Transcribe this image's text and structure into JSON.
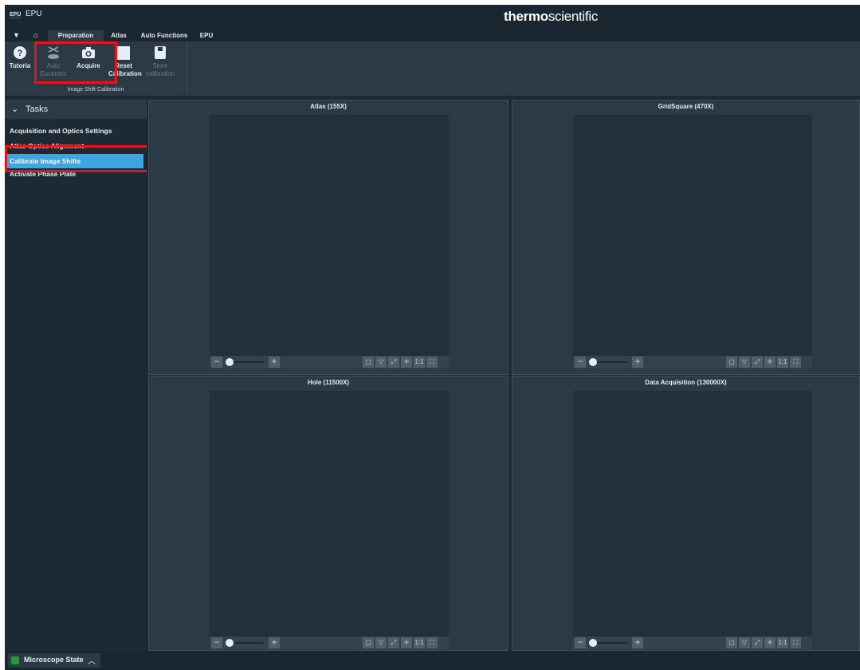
{
  "app": {
    "badge": "EPU",
    "title": "EPU",
    "brand_bold": "thermo",
    "brand_light": "scientific"
  },
  "tabs": [
    {
      "label": "Preparation"
    },
    {
      "label": "Atlas"
    },
    {
      "label": "Auto Functions"
    },
    {
      "label": "EPU"
    }
  ],
  "ribbon": {
    "tutorial": "Tutoria",
    "auto_eucentric_1": "Auto",
    "auto_eucentric_2": "Eucentric",
    "acquire": "Acquire",
    "reset_1": "Reset",
    "reset_2": "Calibration",
    "store_1": "Store",
    "store_2": "calibration",
    "group_label": "Image Shift Calibration"
  },
  "sidebar": {
    "header": "Tasks",
    "items": [
      {
        "label": "Acquisition and Optics Settings"
      },
      {
        "label": "Atlas Optics Alignment"
      },
      {
        "label": "Calibrate Image Shifts"
      },
      {
        "label": "Activate Phase Plate"
      }
    ]
  },
  "panels": [
    {
      "title": "Atlas (155X)"
    },
    {
      "title": "GridSquare (470X)"
    },
    {
      "title": "Hole (11500X)"
    },
    {
      "title": "Data Acquisition (130000X)"
    }
  ],
  "toolbar_tools": [
    "▢",
    "▽",
    "⤢",
    "✛",
    "1:1",
    "⛶"
  ],
  "status": {
    "label": "Microscope State",
    "color": "#1f9d3a"
  },
  "accent": {
    "selection": "#3da5e0",
    "highlight": "#e8141c"
  }
}
